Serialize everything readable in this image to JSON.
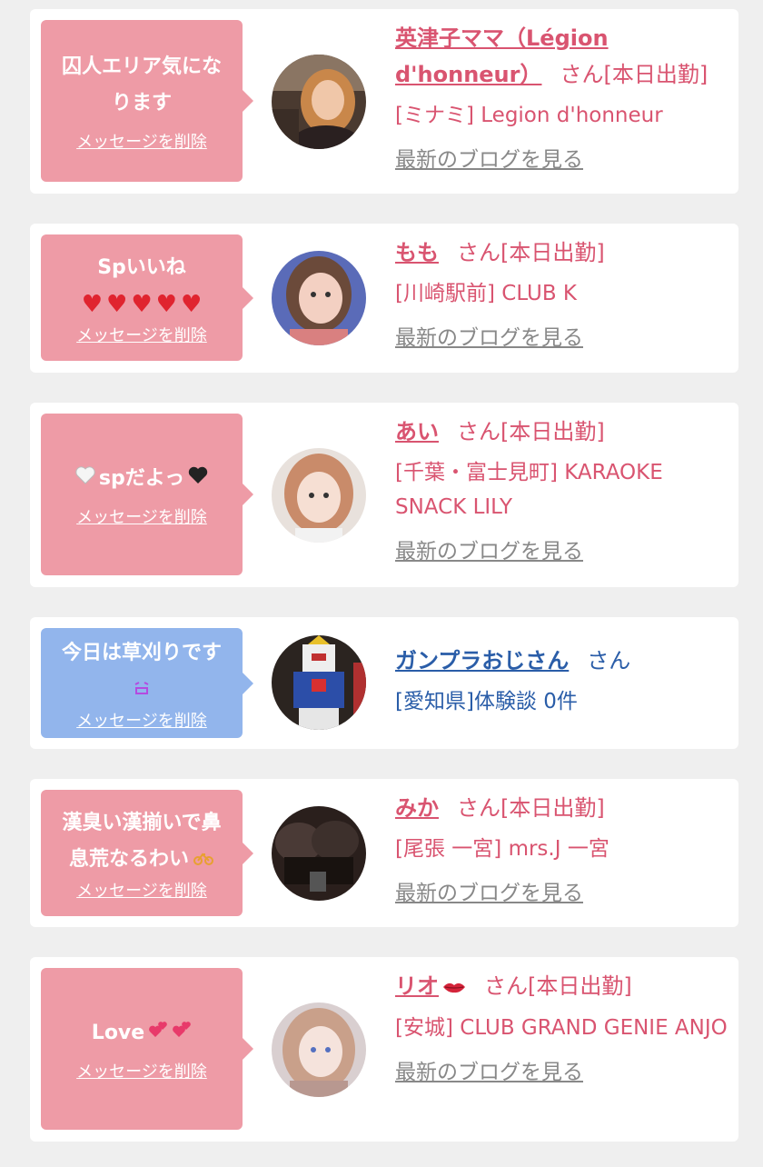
{
  "delete_label": "メッセージを削除",
  "blog_label": "最新のブログを見る",
  "colors": {
    "pink_bubble": "#ee9ba6",
    "blue_bubble": "#92b5ec",
    "pink_text": "#d95470",
    "blue_text": "#2a5da8"
  },
  "items": [
    {
      "message": [
        "囚人エリア気にな",
        "ります"
      ],
      "name": "英津子ママ（Légion d'honneur）",
      "suffix": "さん[本日出勤]",
      "shop": "[ミナミ] Legion d'honneur"
    },
    {
      "message": [
        "Spいいね"
      ],
      "name": "もも",
      "suffix": "さん[本日出勤]",
      "shop": "[川崎駅前] CLUB K"
    },
    {
      "message": [
        "spだよっ"
      ],
      "name": "あい",
      "suffix": "さん[本日出勤]",
      "shop": "[千葉・富士見町] KARAOKE SNACK LILY"
    },
    {
      "message": [
        "今日は草刈りです"
      ],
      "name": "ガンプラおじさん",
      "suffix": "さん",
      "shop": "[愛知県]体験談 0件"
    },
    {
      "message": [
        "漢臭い漢揃いで鼻",
        "息荒なるわい"
      ],
      "name": "みか",
      "suffix": "さん[本日出勤]",
      "shop": "[尾張 一宮] mrs.J 一宮"
    },
    {
      "message": [
        "Love"
      ],
      "name": "リオ",
      "suffix": "さん[本日出勤]",
      "shop": "[安城] CLUB GRAND GENIE ANJO"
    }
  ]
}
